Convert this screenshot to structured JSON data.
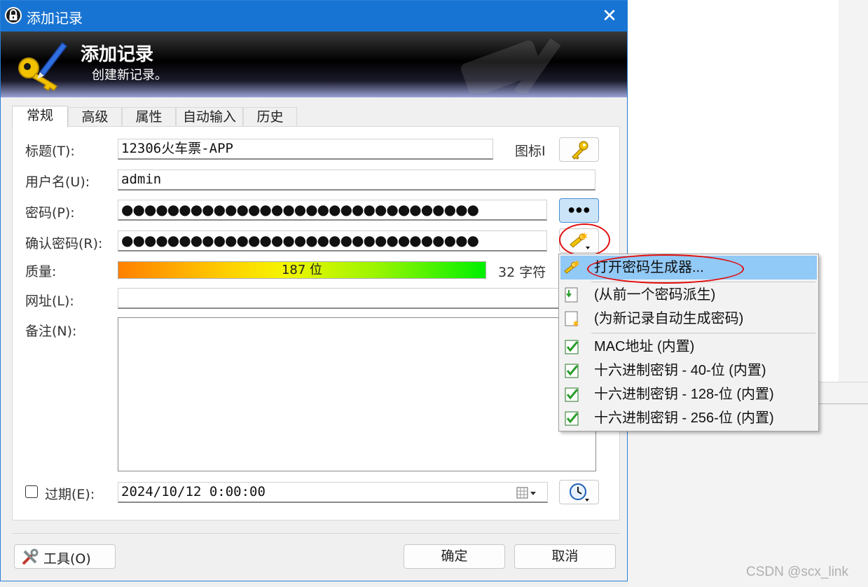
{
  "window": {
    "title": "添加记录",
    "header_title": "添加记录",
    "header_subtitle": "创建新记录。"
  },
  "tabs": [
    {
      "label": "常规",
      "active": true
    },
    {
      "label": "高级"
    },
    {
      "label": "属性"
    },
    {
      "label": "自动输入"
    },
    {
      "label": "历史"
    }
  ],
  "form": {
    "title_label": "标题(T):",
    "title_value": "12306火车票-APP",
    "icon_label": "图标I",
    "username_label": "用户名(U):",
    "username_value": "admin",
    "password_label": "密码(P):",
    "password_value": "●●●●●●●●●●●●●●●●●●●●●●●●●●●●●●●",
    "show_password_button": "●●●",
    "confirm_label": "确认密码(R):",
    "confirm_value": "●●●●●●●●●●●●●●●●●●●●●●●●●●●●●●●",
    "quality_label": "质量:",
    "quality_bits": "187 位",
    "quality_chars": "32 字符",
    "url_label": "网址(L):",
    "url_value": "",
    "notes_label": "备注(N):",
    "notes_value": "",
    "expires_label": "过期(E):",
    "expires_checked": false,
    "expires_value": "2024/10/12   0:00:00"
  },
  "footer": {
    "tools_button": "工具(O)",
    "ok_button": "确定",
    "cancel_button": "取消"
  },
  "password_menu": [
    {
      "label": "打开密码生成器...",
      "highlighted": true,
      "icon": "key-generator-icon"
    },
    {
      "label": "(从前一个密码派生)",
      "icon": "derive-icon"
    },
    {
      "label": "(为新记录自动生成密码)",
      "icon": "auto-generate-icon"
    },
    {
      "label": "MAC地址 (内置)",
      "icon": "checklist-icon"
    },
    {
      "label": "十六进制密钥 - 40-位 (内置)",
      "icon": "checklist-icon"
    },
    {
      "label": "十六进制密钥 - 128-位 (内置)",
      "icon": "checklist-icon"
    },
    {
      "label": "十六进制密钥 - 256-位 (内置)",
      "icon": "checklist-icon"
    }
  ],
  "watermark": "CSDN @scx_link",
  "colors": {
    "titlebar": "#1874d2",
    "menu_highlight": "#91c9f7",
    "annotation_red": "#e01010"
  }
}
